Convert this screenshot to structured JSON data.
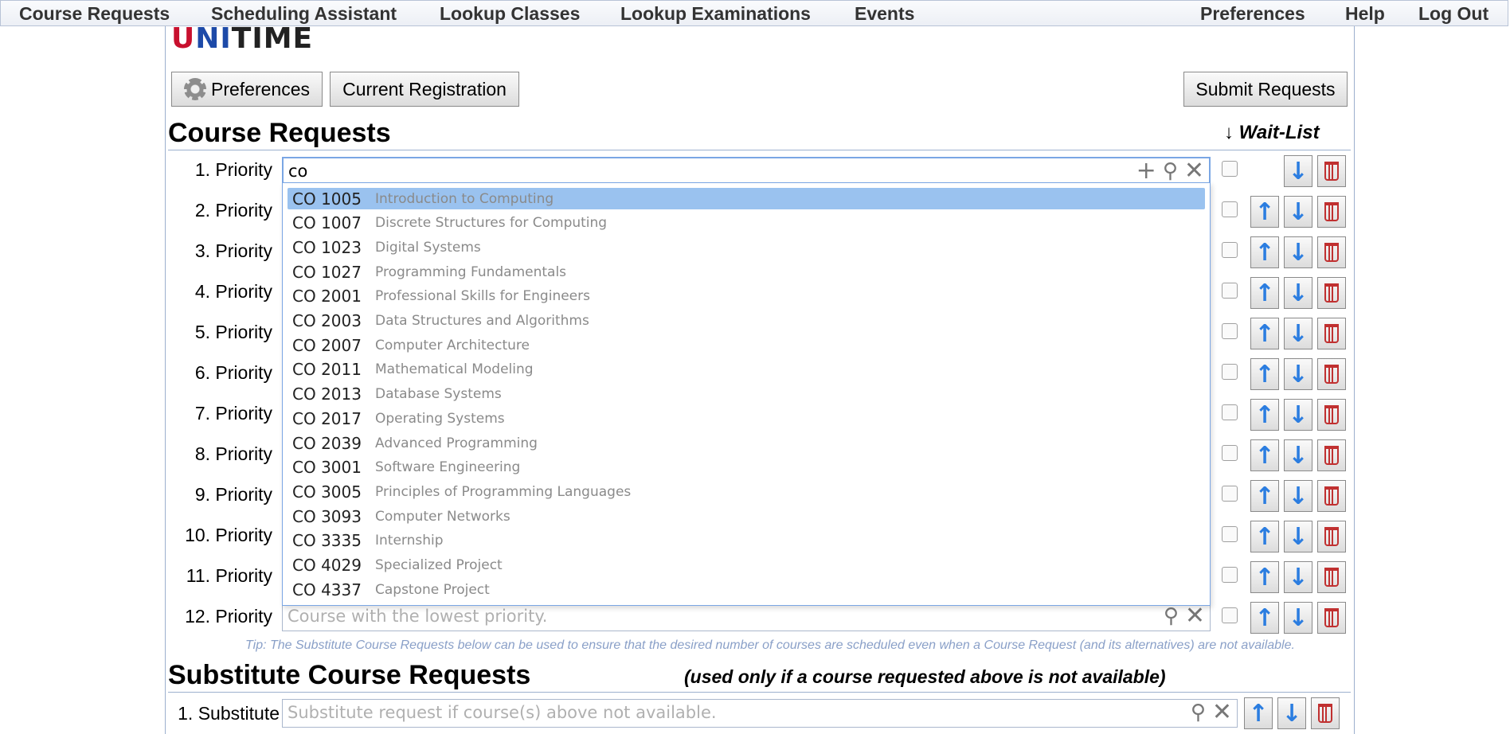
{
  "menu": {
    "left": [
      "Course Requests",
      "Scheduling Assistant",
      "Lookup Classes",
      "Lookup Examinations",
      "Events"
    ],
    "right": [
      "Preferences",
      "Help",
      "Log Out"
    ]
  },
  "logo": {
    "u": "U",
    "n": "NI",
    "t": "T",
    "i": "IME"
  },
  "toolbar": {
    "preferences": "Preferences",
    "current_registration": "Current Registration",
    "submit": "Submit Requests"
  },
  "course_requests": {
    "title": "Course Requests",
    "waitlist_label": "↓ Wait-List",
    "search_value": "co",
    "lowest_placeholder": "Course with the lowest priority.",
    "priorities": [
      "1. Priority",
      "2. Priority",
      "3. Priority",
      "4. Priority",
      "5. Priority",
      "6. Priority",
      "7. Priority",
      "8. Priority",
      "9. Priority",
      "10. Priority",
      "11. Priority",
      "12. Priority"
    ]
  },
  "suggestions": [
    {
      "code": "CO 1005",
      "title": "Introduction to Computing"
    },
    {
      "code": "CO 1007",
      "title": "Discrete Structures for Computing"
    },
    {
      "code": "CO 1023",
      "title": "Digital Systems"
    },
    {
      "code": "CO 1027",
      "title": "Programming Fundamentals"
    },
    {
      "code": "CO 2001",
      "title": "Professional Skills for Engineers"
    },
    {
      "code": "CO 2003",
      "title": "Data Structures and Algorithms"
    },
    {
      "code": "CO 2007",
      "title": "Computer Architecture"
    },
    {
      "code": "CO 2011",
      "title": "Mathematical Modeling"
    },
    {
      "code": "CO 2013",
      "title": "Database Systems"
    },
    {
      "code": "CO 2017",
      "title": "Operating Systems"
    },
    {
      "code": "CO 2039",
      "title": "Advanced Programming"
    },
    {
      "code": "CO 3001",
      "title": "Software Engineering"
    },
    {
      "code": "CO 3005",
      "title": "Principles of Programming Languages"
    },
    {
      "code": "CO 3093",
      "title": "Computer Networks"
    },
    {
      "code": "CO 3335",
      "title": "Internship"
    },
    {
      "code": "CO 4029",
      "title": "Specialized Project"
    },
    {
      "code": "CO 4337",
      "title": "Capstone Project"
    }
  ],
  "tip": "Tip: The Substitute Course Requests below can be used to ensure that the desired number of courses are scheduled even when a Course Request (and its alternatives) are not available.",
  "substitutes": {
    "title": "Substitute Course Requests",
    "note": "(used only if a course requested above is not available)",
    "label": "1. Substitute",
    "placeholder": "Substitute request if course(s) above not available."
  },
  "icons": {
    "add": "plus-icon",
    "search": "search-icon",
    "clear": "close-icon",
    "up": "arrow-up-icon",
    "down": "arrow-down-icon",
    "delete": "trash-icon"
  },
  "colors": {
    "selected_row": "#9ac2ef",
    "arrow": "#2b7de0",
    "delete": "#c03030",
    "tip": "#8aa0c8"
  }
}
